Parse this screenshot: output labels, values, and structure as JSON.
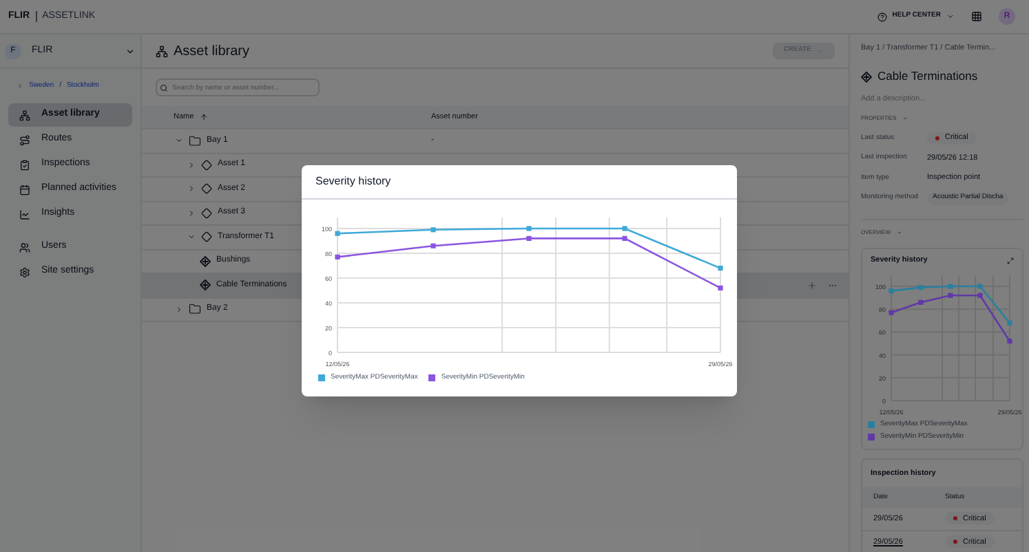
{
  "topbar": {
    "logo": "FLIR",
    "product": "ASSETLINK",
    "help": "HELP CENTER",
    "avatar": "R"
  },
  "sidebar": {
    "org_initial": "F",
    "org": "FLIR",
    "breadcrumb": [
      {
        "label": "Sweden"
      },
      {
        "label": "Stockholm"
      }
    ],
    "breadcrumb_separator": "/",
    "items": [
      {
        "label": "Asset library",
        "selected": true
      },
      {
        "label": "Routes",
        "selected": false
      },
      {
        "label": "Inspections",
        "selected": false
      },
      {
        "label": "Planned activities",
        "selected": false
      },
      {
        "label": "Insights",
        "selected": false
      }
    ],
    "items2": [
      {
        "label": "Users",
        "selected": false
      },
      {
        "label": "Site settings",
        "selected": false
      }
    ]
  },
  "main": {
    "title": "Asset library",
    "create": "CREATE",
    "search": {
      "placeholder": "Search by name or asset number..."
    },
    "columns": [
      {
        "label": "Name"
      },
      {
        "label": "Asset number"
      }
    ],
    "rows": [
      {
        "name": "Bay 1",
        "kind": "folder",
        "asset_number": "-",
        "expanded": true,
        "selected": false,
        "children": [
          {
            "name": "Asset 1",
            "kind": "asset",
            "expanded": false,
            "selected": false
          },
          {
            "name": "Asset 2",
            "kind": "asset",
            "expanded": false,
            "selected": false
          },
          {
            "name": "Asset 3",
            "kind": "asset",
            "expanded": false,
            "selected": false
          },
          {
            "name": "Transformer T1",
            "kind": "asset",
            "expanded": true,
            "selected": false,
            "children": [
              {
                "name": "Bushings",
                "kind": "point",
                "selected": false
              },
              {
                "name": "Cable Terminations",
                "kind": "point",
                "selected": true
              }
            ]
          }
        ]
      },
      {
        "name": "Bay 2",
        "kind": "folder",
        "expanded": false,
        "selected": false
      }
    ]
  },
  "detail": {
    "breadcrumb": "Bay 1 / Transformer T1 / Cable Termin...",
    "title": "Cable Terminations",
    "description": {
      "placeholder": "Add a description..."
    },
    "properties_label": "PROPERTIES",
    "properties": [
      {
        "label": "Last status",
        "value": "Critical",
        "kind": "status"
      },
      {
        "label": "Last inspection",
        "value": "29/05/26 12:18",
        "kind": "text"
      },
      {
        "label": "Item type",
        "value": "Inspection point",
        "kind": "text"
      },
      {
        "label": "Monitoring method",
        "value": "Acoustic Partial Discha",
        "kind": "chip"
      }
    ],
    "overview_label": "OVERVIEW",
    "severity_card": {
      "title": "Severity history",
      "chart_data": {
        "type": "line",
        "grid": true,
        "legend": "bottom",
        "categories": [
          "12/05/26",
          null,
          null,
          null,
          "29/05/26"
        ],
        "ylim": [
          0,
          100
        ],
        "yticks": [
          0,
          20,
          40,
          60,
          80,
          100
        ],
        "series": [
          {
            "name": "SeverityMax PDSeverityMax",
            "color": "#2b7f9e",
            "marker": "square",
            "values": [
              96,
              99,
              100,
              100,
              68
            ]
          },
          {
            "name": "SeverityMin PDSeverityMin",
            "color": "#5f3aa6",
            "marker": "square",
            "values": [
              77,
              86,
              92,
              92,
              52
            ]
          }
        ]
      }
    },
    "history": {
      "title": "Inspection history",
      "columns": [
        "Date",
        "Status"
      ],
      "rows": [
        {
          "date": "29/05/26",
          "status": "Critical",
          "link": false
        },
        {
          "date": "29/05/26",
          "status": "Critical",
          "link": true
        }
      ]
    }
  },
  "modal": {
    "title": "Severity history",
    "chart_data": {
      "type": "line",
      "grid": true,
      "legend": "bottom",
      "categories": [
        "12/05/26",
        null,
        null,
        null,
        "29/05/26"
      ],
      "ylim": [
        0,
        100
      ],
      "yticks": [
        0,
        20,
        40,
        60,
        80,
        100
      ],
      "series": [
        {
          "name": "SeverityMax PDSeverityMax",
          "color": "#3fa9d8",
          "marker": "square",
          "values": [
            96,
            99,
            100,
            100,
            68
          ]
        },
        {
          "name": "SeverityMin PDSeverityMin",
          "color": "#8b55e0",
          "marker": "square",
          "values": [
            77,
            86,
            92,
            92,
            52
          ]
        }
      ]
    }
  }
}
